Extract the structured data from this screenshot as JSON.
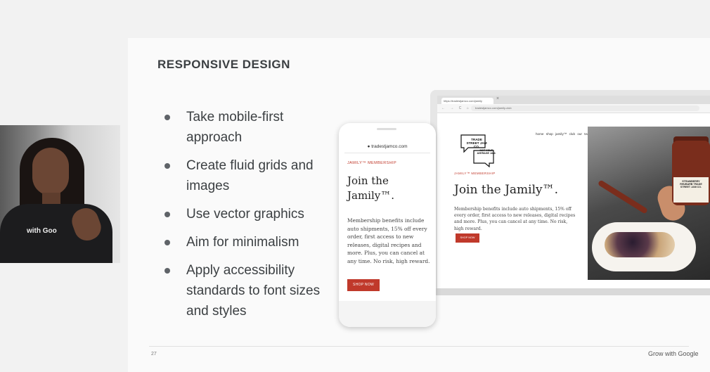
{
  "slide": {
    "title": "RESPONSIVE DESIGN",
    "bullets": [
      "Take mobile-first approach",
      "Create fluid grids and images",
      "Use vector graphics",
      "Aim for minimalism",
      "Apply accessibility standards to font sizes and styles"
    ],
    "page_number": "27",
    "brand": "Grow with Google"
  },
  "webcam": {
    "shirt_text": "with Goo"
  },
  "phone": {
    "url": "● tradestjamco.com",
    "kicker": "JAMILY™ MEMBERSHIP",
    "heading": "Join the Jamily™.",
    "body": "Membership benefits include auto shipments, 15% off every order, first access to new releases, digital recipes and more. Plus, you can cancel at any time. No risk, high reward.",
    "button": "SHOP NOW"
  },
  "laptop": {
    "tab_title": "https://tradestjamco.com/jamily",
    "tab_close": "×",
    "nav_controls": "← → C ⌂",
    "address": "tradestjamco.com/jamily-club",
    "logo_text_top": "TRADE STREET JAM CO.",
    "logo_text_badge": "NOT YOUR AVERAGE JAM.",
    "nav": "home  shop  jamily™ club  our team",
    "kicker": "JAMILY™ MEMBERSHIP",
    "heading": "Join the Jamily™.",
    "body": "Membership benefits include auto shipments, 15% off every order, first access to new releases, digital recipes and more. Plus, you can cancel at any time. No risk, high reward.",
    "button": "SHOP NOW",
    "jar_label": "STRAWBERRY RHUBARB TRADE STREET JAM CO."
  },
  "colors": {
    "accent": "#c0392b",
    "text": "#3c4043",
    "slide_bg": "#fafafa"
  }
}
